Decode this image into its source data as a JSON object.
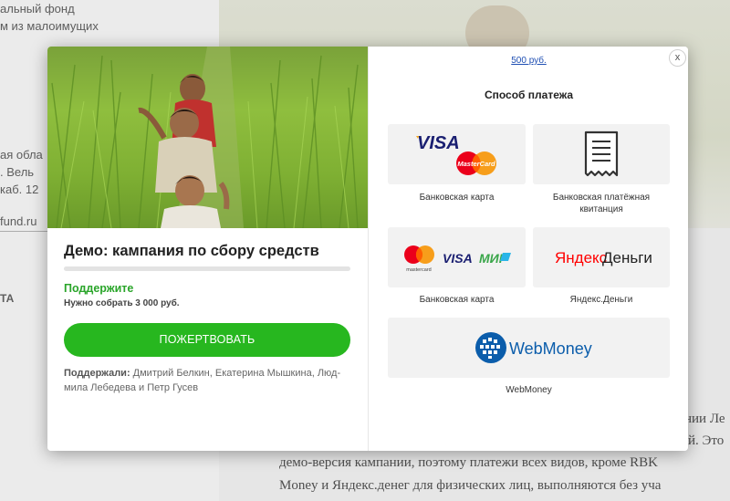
{
  "background": {
    "left_lines": [
      "альный фонд",
      "м из малоимущих",
      "ая обла",
      ". Вель",
      "каб. 12",
      "fund.ru",
      "ТА"
    ],
    "right_lines": [
      "нии Ле",
      "й. Это"
    ],
    "bottom_lines": [
      "демо-версия кампании, поэтому платежи всех видов, кроме RBK",
      "Money и Яндекс.денег для физических лиц, выполняются без уча"
    ]
  },
  "modal": {
    "campaign": {
      "title": "Демо: кампания по сбору средств",
      "progress_fraction": 0.0,
      "support_label": "Поддержите",
      "goal_text": "Нужно собрать 3 000  руб.",
      "donate_button": "ПОЖЕРТВОВАТЬ",
      "supporters_prefix": "Поддержали:",
      "supporters_names": " Дмитрий Белкин, Екатерина Мышкина, Люд-мила Лебедева и Петр Гусев"
    },
    "payment": {
      "amount_link": "500 руб.",
      "close": "x",
      "heading": "Способ платежа",
      "methods": [
        {
          "label": "Банковская карта",
          "icons": [
            "visa-logo",
            "mastercard-logo"
          ],
          "logo_text": [
            "VISA",
            "MasterCard"
          ]
        },
        {
          "label": "Банковская платёжная квитанция",
          "icons": [
            "receipt-icon"
          ]
        },
        {
          "label": "Банковская карта",
          "icons": [
            "mastercard-logo",
            "visa-logo",
            "mir-logo"
          ],
          "logo_text": [
            "mastercard",
            "VISA",
            "МИР"
          ]
        },
        {
          "label": "Яндекс.Деньги",
          "icons": [
            "yandex-money-logo"
          ],
          "logo_text": [
            "Яндекс",
            "Деньги"
          ]
        },
        {
          "label": "WebMoney",
          "icons": [
            "webmoney-logo"
          ],
          "logo_text": [
            "WebMoney"
          ]
        }
      ]
    }
  },
  "colors": {
    "accent_green": "#27b71f",
    "support_green": "#2aa52a",
    "link_blue": "#1f4fb3",
    "visa_blue": "#1a1f71",
    "mastercard_red": "#eb001b",
    "mastercard_orange": "#f79e1b",
    "yandex_red": "#ff0000",
    "webmoney_blue": "#0b5dab"
  }
}
